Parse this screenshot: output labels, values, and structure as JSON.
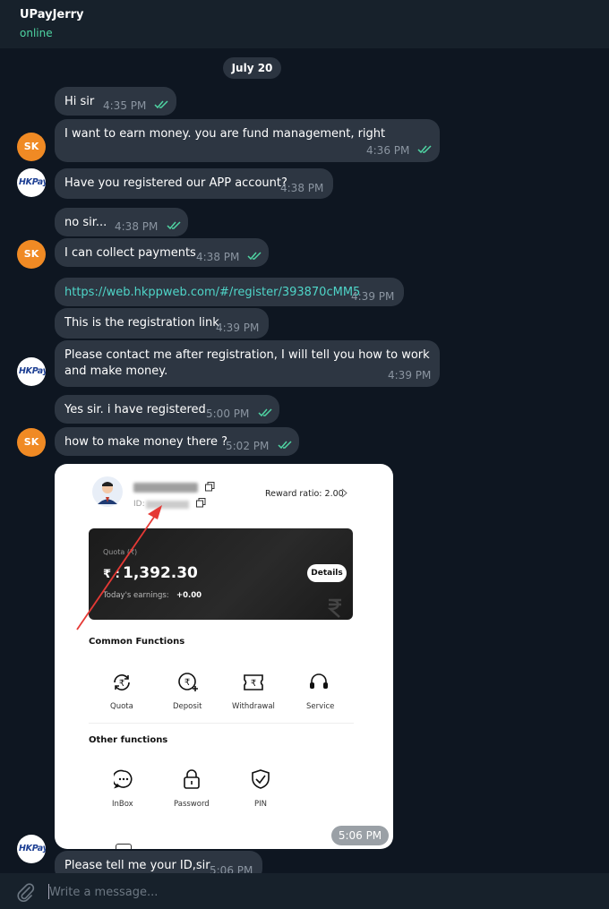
{
  "header": {
    "title": "UPayJerry",
    "status": "online"
  },
  "date_divider": "July 20",
  "messages": [
    {
      "text": "Hi sir",
      "time": "4:35 PM"
    },
    {
      "text": "I want to earn money. you are fund management, right",
      "time": "4:36 PM"
    },
    {
      "text": "Have you registered our APP account?",
      "time": "4:38 PM"
    },
    {
      "text": "no sir...",
      "time": "4:38 PM"
    },
    {
      "text": "I can collect payments",
      "time": "4:38 PM"
    },
    {
      "text": "https://web.hkppweb.com/#/register/393870cMM5",
      "time": "4:39 PM"
    },
    {
      "text": "This is the registration link",
      "time": "4:39 PM"
    },
    {
      "text": "Please contact me after registration, I will tell you how to work and make money.",
      "time": "4:39 PM"
    },
    {
      "text": "Yes sir. i have registered",
      "time": "5:00 PM"
    },
    {
      "text": "how to make money there ?",
      "time": "5:02 PM"
    },
    {
      "text": "Please tell me your ID,sir",
      "time": "5:06 PM"
    }
  ],
  "avatars": {
    "user_initials": "SK",
    "contact_logo": "HKPay"
  },
  "screenshot": {
    "time": "5:06 PM",
    "id_prefix": "ID:",
    "reward_ratio": "Reward ratio: 2.00",
    "quota_label": "Quota (₹)",
    "quota_value": "1,392.30",
    "currency": "₹ :",
    "earnings_label": "Today's earnings:",
    "earnings_value": "+0.00",
    "details_label": "Details",
    "common_title": "Common Functions",
    "common_items": [
      "Quota",
      "Deposit",
      "Withdrawal",
      "Service"
    ],
    "other_title": "Other functions",
    "other_items": [
      "InBox",
      "Password",
      "PIN"
    ]
  },
  "input": {
    "placeholder": "Write a message..."
  },
  "colors": {
    "background": "#0e1621",
    "header": "#17212b",
    "bubble": "#2d3642",
    "accent": "#4fd5a3",
    "link": "#4fd5c8",
    "user_avatar": "#f08a24",
    "arrow": "#e53935"
  }
}
